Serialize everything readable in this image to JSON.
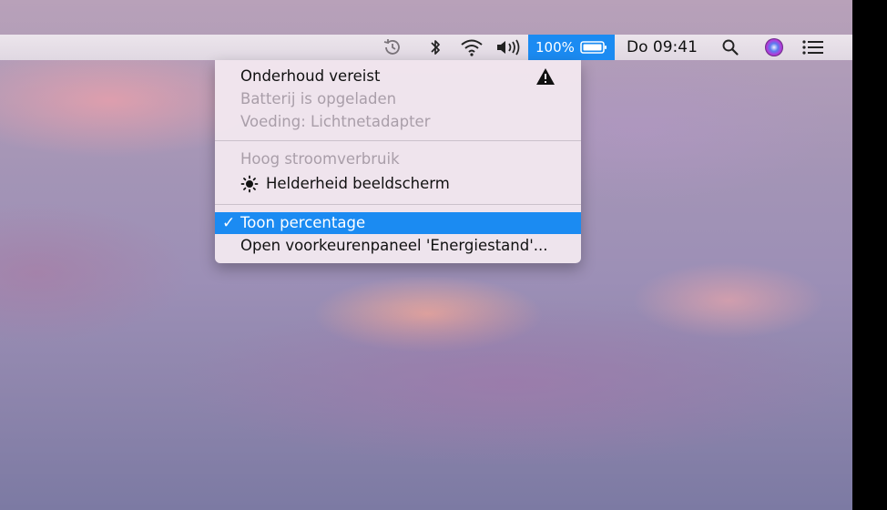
{
  "menubar": {
    "battery_percent": "100%",
    "clock": "Do 09:41",
    "icons": [
      "time-machine-icon",
      "bluetooth-icon",
      "wifi-icon",
      "volume-icon",
      "battery-icon",
      "spotlight-search-icon",
      "siri-icon",
      "notification-center-icon"
    ]
  },
  "battery_menu": {
    "status_title": "Onderhoud vereist",
    "battery_status": "Batterij is opgeladen",
    "power_source": "Voeding: Lichtnetadapter",
    "high_usage_header": "Hoog stroomverbruik",
    "app_item": "Helderheid beeldscherm",
    "show_percentage": "Toon percentage",
    "show_percentage_checked": true,
    "open_prefs": "Open voorkeurenpaneel 'Energiestand'..."
  },
  "colors": {
    "selection": "#1b8bf2",
    "menubar": "#e6dfe7"
  }
}
